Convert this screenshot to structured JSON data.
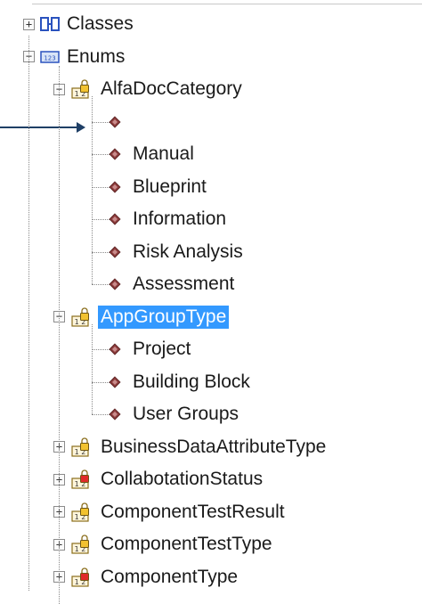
{
  "tree": {
    "roots": [
      {
        "label": "Classes",
        "expanded": false,
        "icon": "class-diagram-icon"
      },
      {
        "label": "Enums",
        "expanded": true,
        "icon": "enum-folder-icon"
      }
    ],
    "enums": [
      {
        "label": "AlfaDocCategory",
        "expanded": true,
        "lock": "yellow",
        "selected": false,
        "values": [
          "",
          "Manual",
          "Blueprint",
          "Information",
          "Risk Analysis",
          "Assessment"
        ]
      },
      {
        "label": "AppGroupType",
        "expanded": true,
        "lock": "yellow",
        "selected": true,
        "values": [
          "Project",
          "Building Block",
          "User Groups"
        ]
      },
      {
        "label": "BusinessDataAttributeType",
        "expanded": false,
        "lock": "yellow",
        "selected": false,
        "values": []
      },
      {
        "label": "CollabotationStatus",
        "expanded": false,
        "lock": "red",
        "selected": false,
        "values": []
      },
      {
        "label": "ComponentTestResult",
        "expanded": false,
        "lock": "yellow",
        "selected": false,
        "values": []
      },
      {
        "label": "ComponentTestType",
        "expanded": false,
        "lock": "yellow",
        "selected": false,
        "values": []
      },
      {
        "label": "ComponentType",
        "expanded": false,
        "lock": "red",
        "selected": false,
        "values": []
      }
    ]
  },
  "colors": {
    "selection": "#3399ff",
    "lock_yellow": "#f2c230",
    "lock_red": "#e02a2a",
    "enum_value": "#8a3a3a",
    "arrow": "#1f3f66"
  }
}
